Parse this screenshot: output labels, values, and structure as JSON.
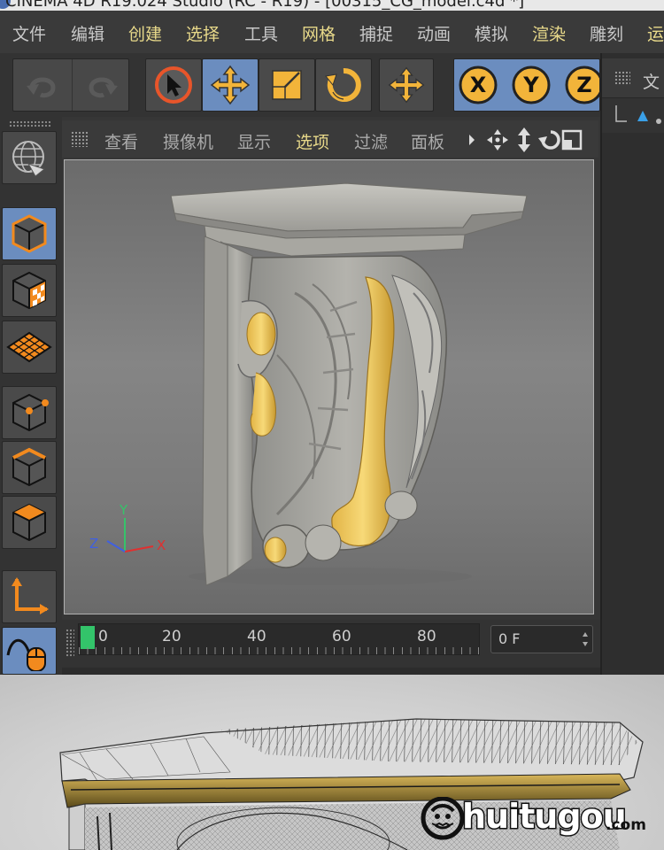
{
  "title_bar": {
    "text": "CINEMA 4D R19.024 Studio (RC - R19) - [00315_CG_model.c4d *]"
  },
  "menu": {
    "items": [
      {
        "label": "文件",
        "highlight": false
      },
      {
        "label": "编辑",
        "highlight": false
      },
      {
        "label": "创建",
        "highlight": true
      },
      {
        "label": "选择",
        "highlight": true
      },
      {
        "label": "工具",
        "highlight": false
      },
      {
        "label": "网格",
        "highlight": true
      },
      {
        "label": "捕捉",
        "highlight": false
      },
      {
        "label": "动画",
        "highlight": false
      },
      {
        "label": "模拟",
        "highlight": false
      },
      {
        "label": "渲染",
        "highlight": true
      },
      {
        "label": "雕刻",
        "highlight": false
      },
      {
        "label": "运",
        "highlight": true
      }
    ]
  },
  "right_panel": {
    "tab_label": "文"
  },
  "viewport_menu": {
    "items": [
      {
        "label": "查看",
        "highlight": false
      },
      {
        "label": "摄像机",
        "highlight": false
      },
      {
        "label": "显示",
        "highlight": false
      },
      {
        "label": "选项",
        "highlight": true
      },
      {
        "label": "过滤",
        "highlight": false
      },
      {
        "label": "面板",
        "highlight": false
      }
    ]
  },
  "viewport": {
    "axis": {
      "x": "X",
      "y": "Y",
      "z": "Z"
    },
    "axis_colors": {
      "x": "#e03030",
      "y": "#36c36a",
      "z": "#4060e0"
    }
  },
  "timeline": {
    "ticks": [
      "0",
      "20",
      "40",
      "60",
      "80"
    ],
    "current_frame": "0 F"
  },
  "watermark": {
    "text": "huitugou",
    "suffix": ".com"
  },
  "colors": {
    "accent": "#6b8dbf",
    "gold": "#f0c24a",
    "marker": "#33c46a"
  }
}
